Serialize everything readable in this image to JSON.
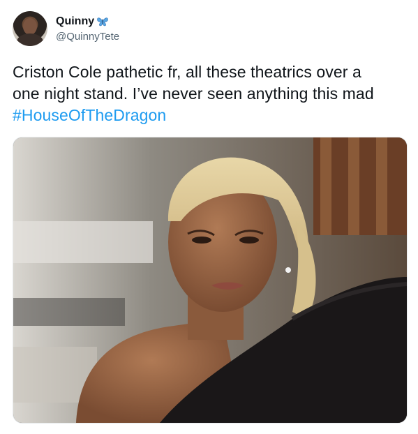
{
  "user": {
    "display_name": "Quinny",
    "handle": "@QuinnyTete",
    "avatar": "profile-photo",
    "badge_icon": "butterfly-emoji"
  },
  "tweet": {
    "text_lines": [
      "Criston Cole pathetic fr, all these theatrics over a",
      "one night stand. I’ve never seen anything this mad"
    ],
    "hashtag": "#HouseOfTheDragon"
  },
  "media": {
    "type": "photo",
    "subject": "woman-in-black-off-shoulder-top-reaction"
  },
  "colors": {
    "link": "#1d9bf0",
    "text": "#0f1419",
    "secondary": "#536471"
  }
}
